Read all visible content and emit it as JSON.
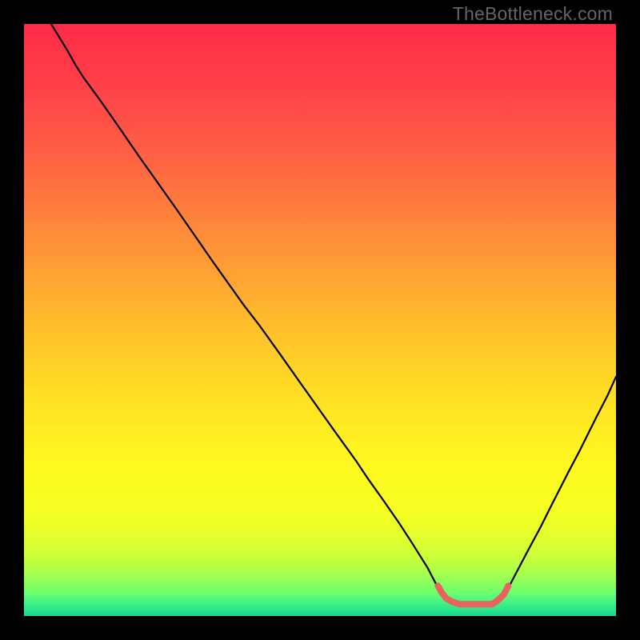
{
  "watermark": "TheBottleneck.com",
  "chart_data": {
    "type": "line",
    "title": "",
    "xlabel": "",
    "ylabel": "",
    "xlim": [
      0,
      100
    ],
    "ylim": [
      0,
      100
    ],
    "grid": false,
    "legend": false,
    "curve": [
      {
        "x": 4.6,
        "y": 100.0
      },
      {
        "x": 7.4,
        "y": 95.4
      },
      {
        "x": 8.8,
        "y": 92.9
      },
      {
        "x": 10.1,
        "y": 90.9
      },
      {
        "x": 12.8,
        "y": 87.2
      },
      {
        "x": 14.9,
        "y": 84.2
      },
      {
        "x": 17.6,
        "y": 80.3
      },
      {
        "x": 19.6,
        "y": 77.4
      },
      {
        "x": 22.3,
        "y": 73.6
      },
      {
        "x": 25.7,
        "y": 68.8
      },
      {
        "x": 28.4,
        "y": 64.9
      },
      {
        "x": 31.8,
        "y": 60.0
      },
      {
        "x": 34.5,
        "y": 56.2
      },
      {
        "x": 37.2,
        "y": 52.4
      },
      {
        "x": 39.9,
        "y": 48.9
      },
      {
        "x": 43.2,
        "y": 44.3
      },
      {
        "x": 46.6,
        "y": 39.5
      },
      {
        "x": 50.0,
        "y": 34.7
      },
      {
        "x": 52.7,
        "y": 30.9
      },
      {
        "x": 56.1,
        "y": 26.2
      },
      {
        "x": 58.1,
        "y": 23.2
      },
      {
        "x": 60.8,
        "y": 19.4
      },
      {
        "x": 63.5,
        "y": 15.5
      },
      {
        "x": 65.5,
        "y": 12.4
      },
      {
        "x": 68.2,
        "y": 8.1
      },
      {
        "x": 69.6,
        "y": 5.4
      },
      {
        "x": 70.7,
        "y": 3.7
      },
      {
        "x": 71.6,
        "y": 2.7
      },
      {
        "x": 72.6,
        "y": 2.0
      },
      {
        "x": 73.5,
        "y": 1.8
      },
      {
        "x": 75.0,
        "y": 1.8
      },
      {
        "x": 77.0,
        "y": 1.8
      },
      {
        "x": 78.5,
        "y": 1.8
      },
      {
        "x": 79.7,
        "y": 2.0
      },
      {
        "x": 80.4,
        "y": 2.7
      },
      {
        "x": 81.8,
        "y": 4.7
      },
      {
        "x": 83.1,
        "y": 7.2
      },
      {
        "x": 85.1,
        "y": 11.0
      },
      {
        "x": 87.2,
        "y": 14.9
      },
      {
        "x": 89.2,
        "y": 18.9
      },
      {
        "x": 91.9,
        "y": 24.2
      },
      {
        "x": 93.9,
        "y": 28.0
      },
      {
        "x": 96.6,
        "y": 33.4
      },
      {
        "x": 98.6,
        "y": 37.3
      },
      {
        "x": 100.0,
        "y": 40.4
      }
    ],
    "highlight_segment": {
      "color": "#e9635c",
      "points": [
        {
          "x": 69.9,
          "y": 5.1
        },
        {
          "x": 70.6,
          "y": 3.9
        },
        {
          "x": 71.3,
          "y": 3.0
        },
        {
          "x": 72.3,
          "y": 2.4
        },
        {
          "x": 73.6,
          "y": 2.0
        },
        {
          "x": 75.7,
          "y": 2.0
        },
        {
          "x": 77.7,
          "y": 2.0
        },
        {
          "x": 79.1,
          "y": 2.0
        },
        {
          "x": 79.7,
          "y": 2.4
        },
        {
          "x": 80.4,
          "y": 3.0
        },
        {
          "x": 81.1,
          "y": 3.7
        },
        {
          "x": 81.8,
          "y": 5.1
        }
      ]
    },
    "gradient_stops": [
      {
        "offset": 0.0,
        "color": "#ff2b47"
      },
      {
        "offset": 0.1,
        "color": "#ff3f48"
      },
      {
        "offset": 0.2,
        "color": "#ff5a45"
      },
      {
        "offset": 0.3,
        "color": "#ff7a3e"
      },
      {
        "offset": 0.4,
        "color": "#ff9a35"
      },
      {
        "offset": 0.5,
        "color": "#ffbb2c"
      },
      {
        "offset": 0.58,
        "color": "#ffd227"
      },
      {
        "offset": 0.66,
        "color": "#ffe722"
      },
      {
        "offset": 0.74,
        "color": "#fff81f"
      },
      {
        "offset": 0.82,
        "color": "#f7ff22"
      },
      {
        "offset": 0.86,
        "color": "#e6ff2a"
      },
      {
        "offset": 0.9,
        "color": "#caff38"
      },
      {
        "offset": 0.93,
        "color": "#a4ff4e"
      },
      {
        "offset": 0.96,
        "color": "#6eff6e"
      },
      {
        "offset": 0.98,
        "color": "#3cf088"
      },
      {
        "offset": 1.0,
        "color": "#17d68d"
      }
    ]
  }
}
